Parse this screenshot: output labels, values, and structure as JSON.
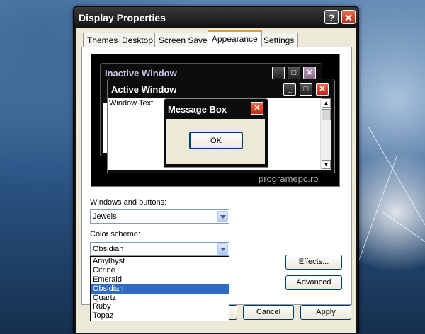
{
  "window": {
    "title": "Display Properties"
  },
  "tabs": [
    {
      "label": "Themes"
    },
    {
      "label": "Desktop"
    },
    {
      "label": "Screen Saver"
    },
    {
      "label": "Appearance"
    },
    {
      "label": "Settings"
    }
  ],
  "preview": {
    "inactive_title": "Inactive Window",
    "active_title": "Active Window",
    "window_text": "Window Text",
    "message_title": "Message Box",
    "ok_label": "OK",
    "watermark": "programepc.ro"
  },
  "windows_buttons": {
    "label": "Windows and buttons:",
    "value": "Jewels"
  },
  "color_scheme": {
    "label": "Color scheme:",
    "value": "Obsidian",
    "options": [
      "Amythyst",
      "Citrine",
      "Emerald",
      "Obsidian",
      "Quartz",
      "Ruby",
      "Topaz"
    ]
  },
  "buttons": {
    "effects": "Effects...",
    "advanced": "Advanced",
    "cancel": "Cancel",
    "apply": "Apply"
  }
}
